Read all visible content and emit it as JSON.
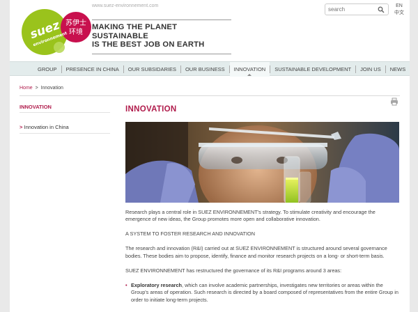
{
  "header": {
    "site_url": "www.suez-environnement.com",
    "logo_text": "suez",
    "logo_sub": "environnement",
    "logo_chinese_line1": "苏伊士",
    "logo_chinese_line2": "环境",
    "tagline_line1": "MAKING THE PLANET SUSTAINABLE",
    "tagline_line2": "IS THE BEST JOB ON EARTH",
    "search_placeholder": "search",
    "lang_en": "EN",
    "lang_cn": "中文"
  },
  "nav": {
    "items": [
      {
        "label": "GROUP"
      },
      {
        "label": "PRESENCE IN CHINA"
      },
      {
        "label": "OUR SUBSIDARIES"
      },
      {
        "label": "OUR BUSINESS"
      },
      {
        "label": "INNOVATION"
      },
      {
        "label": "SUSTAINABLE DEVELOPMENT"
      },
      {
        "label": "JOIN US"
      },
      {
        "label": "NEWS"
      }
    ],
    "active": "INNOVATION"
  },
  "breadcrumb": {
    "home": "Home",
    "separator": ">",
    "current": "Innovation"
  },
  "sidebar": {
    "title": "INNOVATION",
    "items": [
      {
        "arrow": ">",
        "label": "Innovation in China"
      }
    ]
  },
  "main": {
    "title": "INNOVATION",
    "paragraphs": [
      "Research plays a central role in SUEZ ENVIRONNEMENT's strategy. To stimulate creativity and encourage the emergence of new ideas, the Group promotes more open and collaborative innovation.",
      "A SYSTEM TO FOSTER RESEARCH AND INNOVATION",
      "The research and innovation (R&I) carried out at SUEZ ENVIRONNEMENT is structured around several governance bodies. These bodies aim to propose, identify, finance and monitor research projects on a long- or short-term basis.",
      "SUEZ ENVIRONNEMENT has restructured the governance of its R&I programs around 3 areas:"
    ],
    "bullets": [
      {
        "bold": "Exploratory research",
        "text": ", which can involve academic partnerships, investigates new territories or areas within the Group's areas of operation. Such research is directed by a board composed of representatives from the entire Group in order to initiate long-term projects."
      }
    ]
  },
  "colors": {
    "brand_magenta": "#b01b4b",
    "brand_green": "#9ac31c",
    "nav_bg": "#e3ecec"
  },
  "icons": {
    "search": "magnifier-icon",
    "print": "printer-icon"
  }
}
